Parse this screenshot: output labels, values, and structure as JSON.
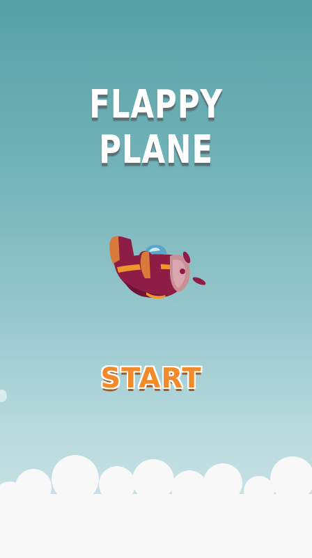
{
  "game": {
    "title": "FLAPPY PLANE",
    "start_label": "START"
  },
  "colors": {
    "sky_top": "#56a1a6",
    "sky_bottom": "#d0e6e8",
    "title_text": "#ffffff",
    "start_text": "#f08a2a",
    "plane_body": "#8e1d45",
    "plane_stripe": "#f0962e",
    "cockpit": "#5aa7c9",
    "clouds": "#f8f8f8"
  },
  "icons": {
    "plane": "red-propeller-plane",
    "clouds": "cloud-bank"
  }
}
